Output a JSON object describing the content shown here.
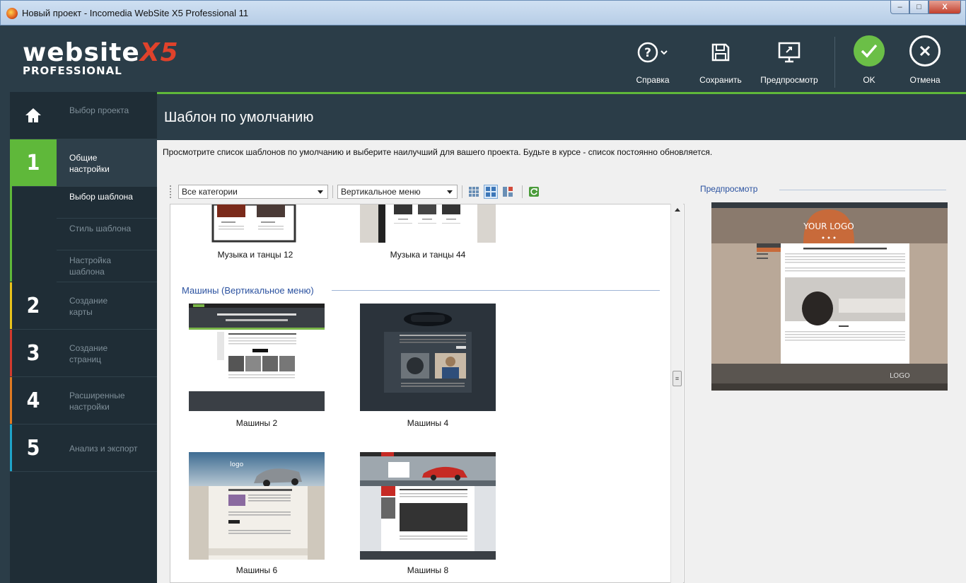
{
  "window": {
    "title": "Новый проект - Incomedia WebSite X5 Professional 11",
    "controls": {
      "minimize": "–",
      "maximize": "□",
      "close": "X"
    }
  },
  "header": {
    "logo_main": "website",
    "logo_x5": "X5",
    "logo_sub": "PROFESSIONAL",
    "buttons": {
      "help": "Справка",
      "save": "Сохранить",
      "preview": "Предпросмотр",
      "ok": "OK",
      "cancel": "Отмена"
    }
  },
  "sidebar": {
    "home": {
      "label": "Выбор проекта"
    },
    "steps": [
      {
        "num": "1",
        "label": "Общие настройки",
        "color": "#5fb83a"
      },
      {
        "num": "2",
        "label": "Создание карты",
        "color": "#e8c21b"
      },
      {
        "num": "3",
        "label": "Создание страниц",
        "color": "#d23a2e"
      },
      {
        "num": "4",
        "label": "Расширенные настройки",
        "color": "#e07a22"
      },
      {
        "num": "5",
        "label": "Анализ и экспорт",
        "color": "#1fa4c9"
      }
    ],
    "substeps": [
      {
        "label": "Выбор шаблона",
        "active": true
      },
      {
        "label": "Стиль шаблона",
        "active": false
      },
      {
        "label": "Настройка шаблона",
        "active": false
      }
    ]
  },
  "page": {
    "title": "Шаблон по умолчанию",
    "description": "Просмотрите список шаблонов по умолчанию и выберите наилучший для вашего проекта. Будьте в курсе - список постоянно обновляется."
  },
  "toolbar": {
    "category_select": "Все категории",
    "menu_select": "Вертикальное меню"
  },
  "templates": {
    "prev_captions": [
      "Музыка и танцы 12",
      "Музыка и танцы 44"
    ],
    "group_title": "Машины (Вертикальное меню)",
    "items": [
      "Машины 2",
      "Машины 4",
      "Машины 6",
      "Машины 8"
    ]
  },
  "preview": {
    "label": "Предпросмотр",
    "logo_text": "YOUR LOGO",
    "footer_logo": "LOGO"
  }
}
